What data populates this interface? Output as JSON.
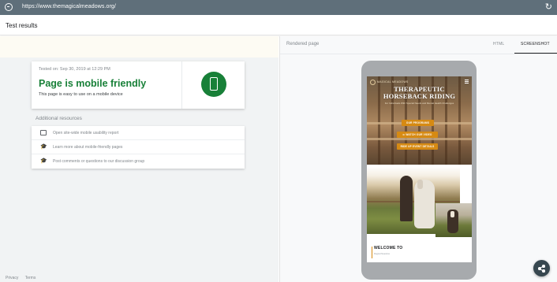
{
  "browser": {
    "url": "https://www.themagicalmeadows.org/",
    "globe_icon": "globe-icon",
    "reload_icon": "reload-icon",
    "reload_glyph": "↻"
  },
  "header": {
    "title": "Test results"
  },
  "result": {
    "tested_on": "Tested on: Sep 30, 2019 at 12:29 PM",
    "headline": "Page is mobile friendly",
    "subtext": "This page is easy to use on a mobile device",
    "badge_icon": "smartphone-icon",
    "accent_color": "#188038"
  },
  "resources": {
    "label": "Additional resources",
    "items": [
      {
        "icon": "browser-window-icon",
        "glyph": "",
        "label": "Open site-wide mobile usability report"
      },
      {
        "icon": "graduation-cap-icon",
        "glyph": "🎓",
        "label": "Learn more about mobile-friendly pages"
      },
      {
        "icon": "graduation-cap-icon",
        "glyph": "🎓",
        "label": "Post comments or questions to our discussion group"
      }
    ]
  },
  "footer": {
    "privacy": "Privacy",
    "terms": "Terms"
  },
  "preview": {
    "label": "Rendered page",
    "tabs": [
      {
        "label": "HTML",
        "active": false
      },
      {
        "label": "SCREENSHOT",
        "active": true
      }
    ]
  },
  "site": {
    "logo": "MAGICAL MEADOWS",
    "title_line1": "THERAPEUTIC",
    "title_line2": "HORSEBACK RIDING",
    "tagline": "For Individuals With Special Needs and Mental Health Challenges",
    "buttons": [
      "OUR PROGRAMS",
      "⊙  WATCH OUR VIDEO",
      "RIDE UP EVENT DETAILS"
    ],
    "welcome": "WELCOME TO",
    "welcome_sub": "Magical Meadows",
    "accent_color": "#d68a13"
  },
  "share": {
    "icon": "share-icon"
  }
}
